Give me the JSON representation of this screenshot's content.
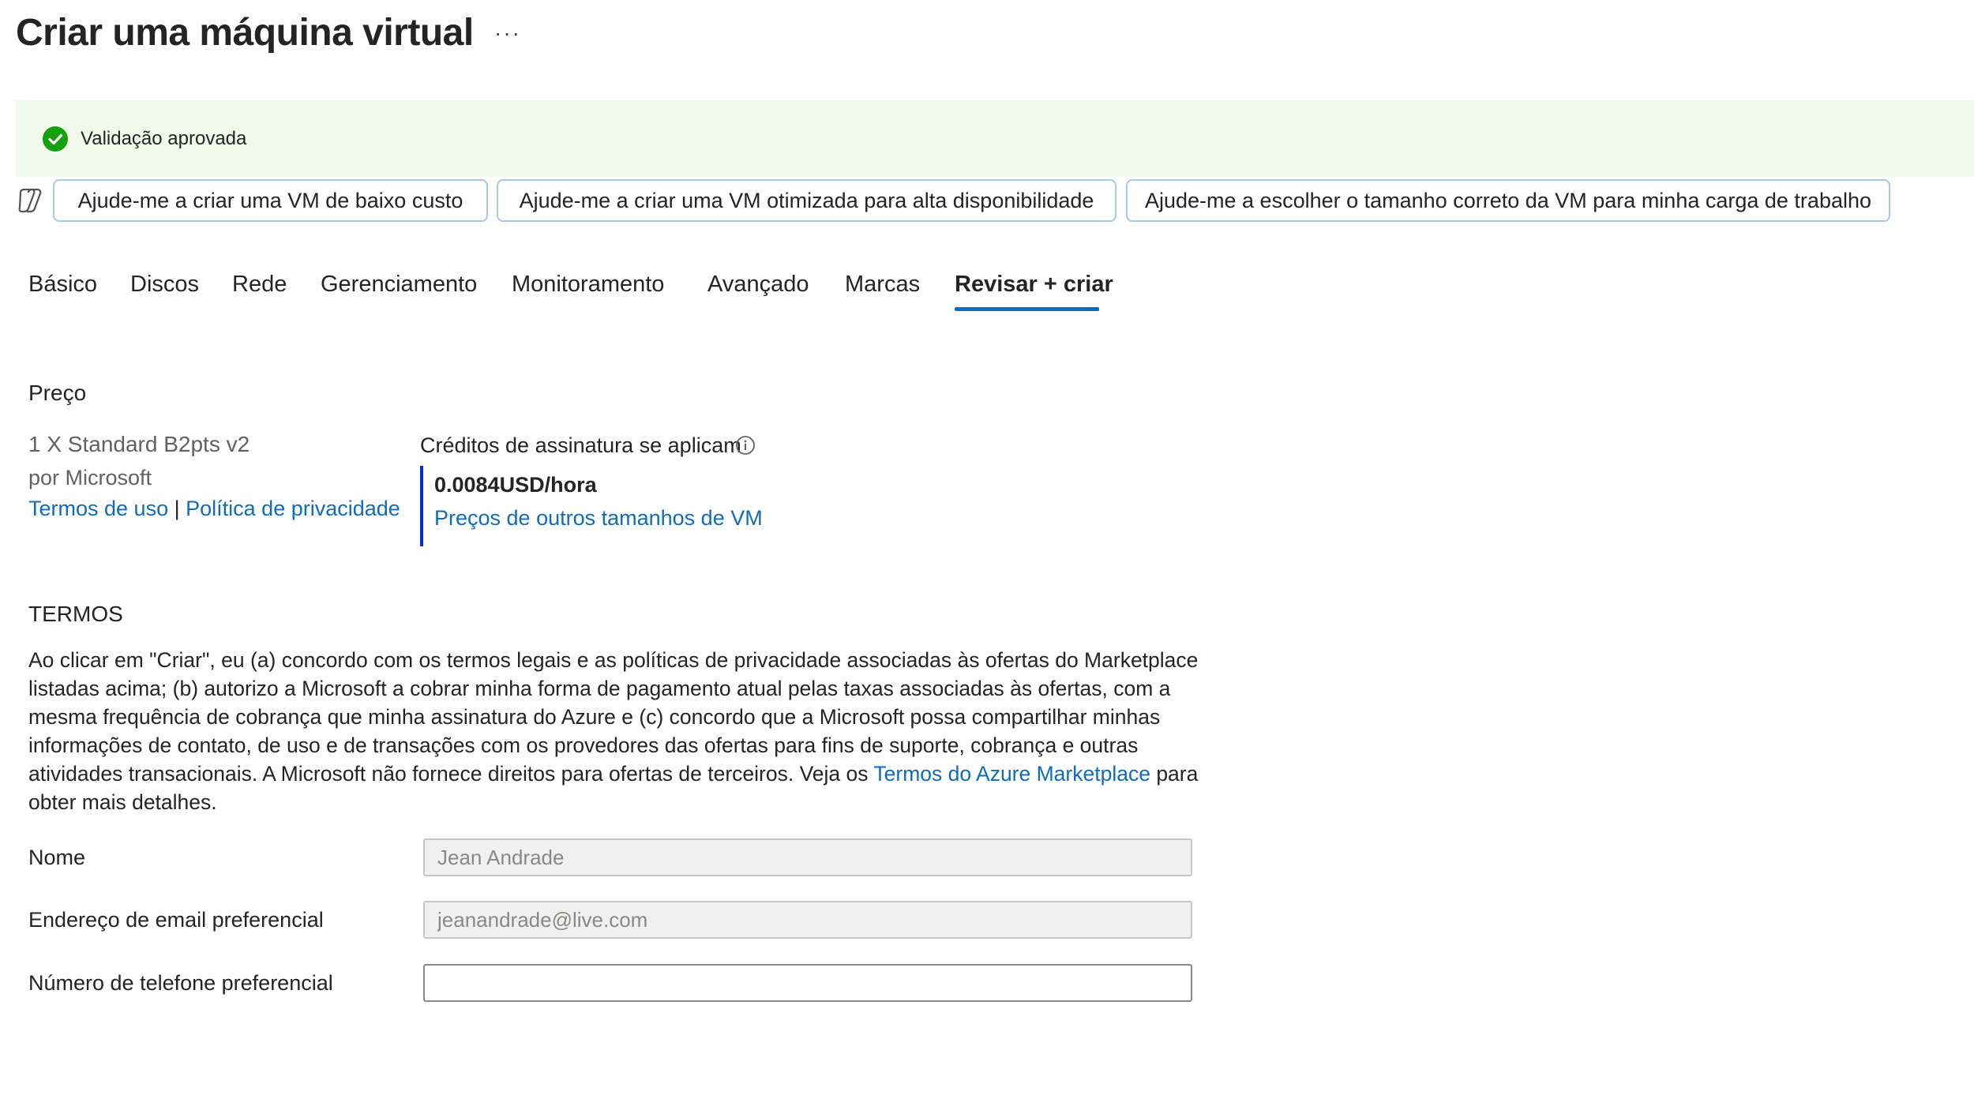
{
  "header": {
    "title": "Criar uma máquina virtual",
    "more_label": "···"
  },
  "banner": {
    "text": "Validação aprovada",
    "status_color": "#13a10e"
  },
  "suggestions": [
    "Ajude-me a criar uma VM de baixo custo",
    "Ajude-me a criar uma VM otimizada para alta disponibilidade",
    "Ajude-me a escolher o tamanho correto da VM para minha carga de trabalho"
  ],
  "tabs": [
    {
      "label": "Básico"
    },
    {
      "label": "Discos"
    },
    {
      "label": "Rede"
    },
    {
      "label": "Gerenciamento"
    },
    {
      "label": "Monitoramento"
    },
    {
      "label": "Avançado"
    },
    {
      "label": "Marcas"
    },
    {
      "label": "Revisar + criar",
      "active": true
    }
  ],
  "pricing": {
    "heading": "Preço",
    "product": "1 X Standard B2pts v2",
    "publisher": "por Microsoft",
    "terms_link": "Termos de uso",
    "separator": "|",
    "privacy_link": "Política de privacidade",
    "credits_label": "Créditos de assinatura se aplicam",
    "price": "0.0084USD/hora",
    "other_sizes_link": "Preços de outros tamanhos de VM"
  },
  "terms": {
    "heading": "TERMOS",
    "text_before_link": "Ao clicar em \"Criar\", eu (a) concordo com os termos legais e as políticas de privacidade associadas às ofertas do Marketplace listadas acima; (b) autorizo a Microsoft a cobrar minha forma de pagamento atual pelas taxas associadas às ofertas, com a mesma frequência de cobrança que minha assinatura do Azure e (c) concordo que a Microsoft possa compartilhar minhas informações de contato, de uso e de transações com os provedores das ofertas para fins de suporte, cobrança e outras atividades transacionais. A Microsoft não fornece direitos para ofertas de terceiros. Veja os ",
    "link": "Termos do Azure Marketplace",
    "text_after_link": " para obter mais detalhes."
  },
  "form": {
    "name_label": "Nome",
    "name_value": "Jean Andrade",
    "email_label": "Endereço de email preferencial",
    "email_value": "jeanandrade@live.com",
    "phone_label": "Número de telefone preferencial",
    "phone_value": ""
  }
}
